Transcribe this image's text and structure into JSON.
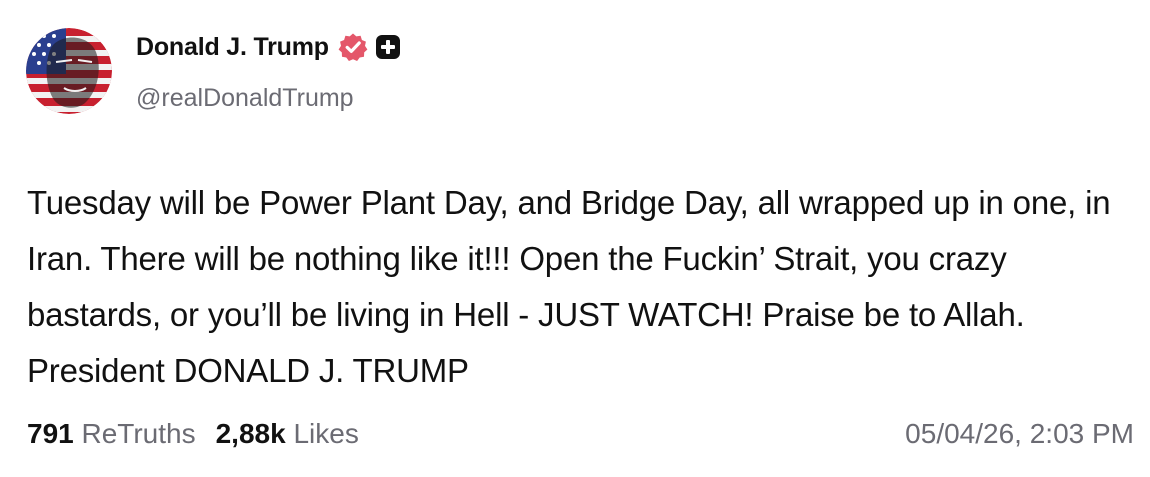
{
  "post": {
    "author": {
      "display_name": "Donald J. Trump",
      "handle": "@realDonaldTrump",
      "verified": true,
      "badge_icon": "verified-badge-icon",
      "extra_icon": "plus-icon"
    },
    "text": "Tuesday will be Power Plant Day, and Bridge Day, all wrapped up in one, in Iran. There will be nothing like it!!! Open the Fuckin’ Strait, you crazy bastards, or you’ll be living in Hell - JUST WATCH! Praise be to Allah. President DONALD J. TRUMP",
    "stats": {
      "retruths_count": "791",
      "retruths_label": "ReTruths",
      "likes_count": "2,88k",
      "likes_label": "Likes"
    },
    "timestamp": "05/04/26, 2:03 PM"
  },
  "colors": {
    "text_primary": "#111111",
    "text_secondary": "#6b6b73",
    "verified_badge": "#e4576a",
    "plus_badge": "#111111",
    "background": "#ffffff"
  }
}
